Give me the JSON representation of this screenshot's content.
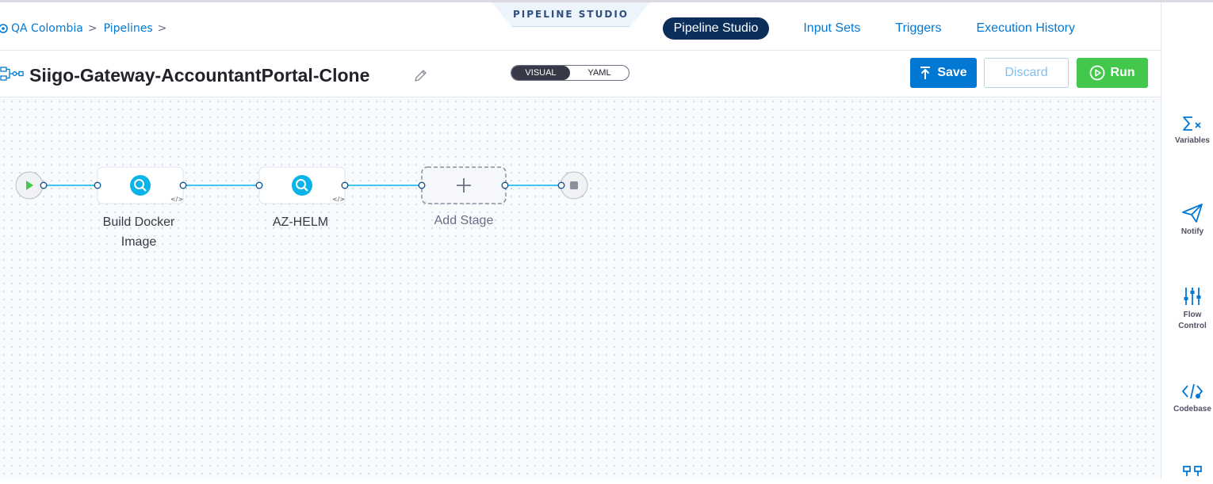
{
  "header": {
    "studio_tab": "PIPELINE STUDIO",
    "breadcrumb": {
      "org": "QA Colombia",
      "pipelines": "Pipelines"
    },
    "nav": {
      "pipeline_studio": "Pipeline Studio",
      "input_sets": "Input Sets",
      "triggers": "Triggers",
      "execution_history": "Execution History"
    }
  },
  "titlebar": {
    "title": "Siigo-Gateway-AccountantPortal-Clone",
    "toggle": {
      "visual": "VISUAL",
      "yaml": "YAML",
      "selected": "VISUAL"
    },
    "buttons": {
      "save": "Save",
      "discard": "Discard",
      "run": "Run"
    }
  },
  "pipeline": {
    "stages": [
      {
        "label_line1": "Build Docker",
        "label_line2": "Image",
        "icon": "search-icon"
      },
      {
        "label_line1": "AZ-HELM",
        "label_line2": "",
        "icon": "search-icon"
      }
    ],
    "add_stage": "Add Stage"
  },
  "rightbar": {
    "variables": "Variables",
    "notify": "Notify",
    "flow_control_1": "Flow",
    "flow_control_2": "Control",
    "codebase": "Codebase"
  },
  "colors": {
    "accent": "#0278d5",
    "connector": "#3dc7f6",
    "run": "#42c84b",
    "nav_active": "#0b2e5b"
  }
}
